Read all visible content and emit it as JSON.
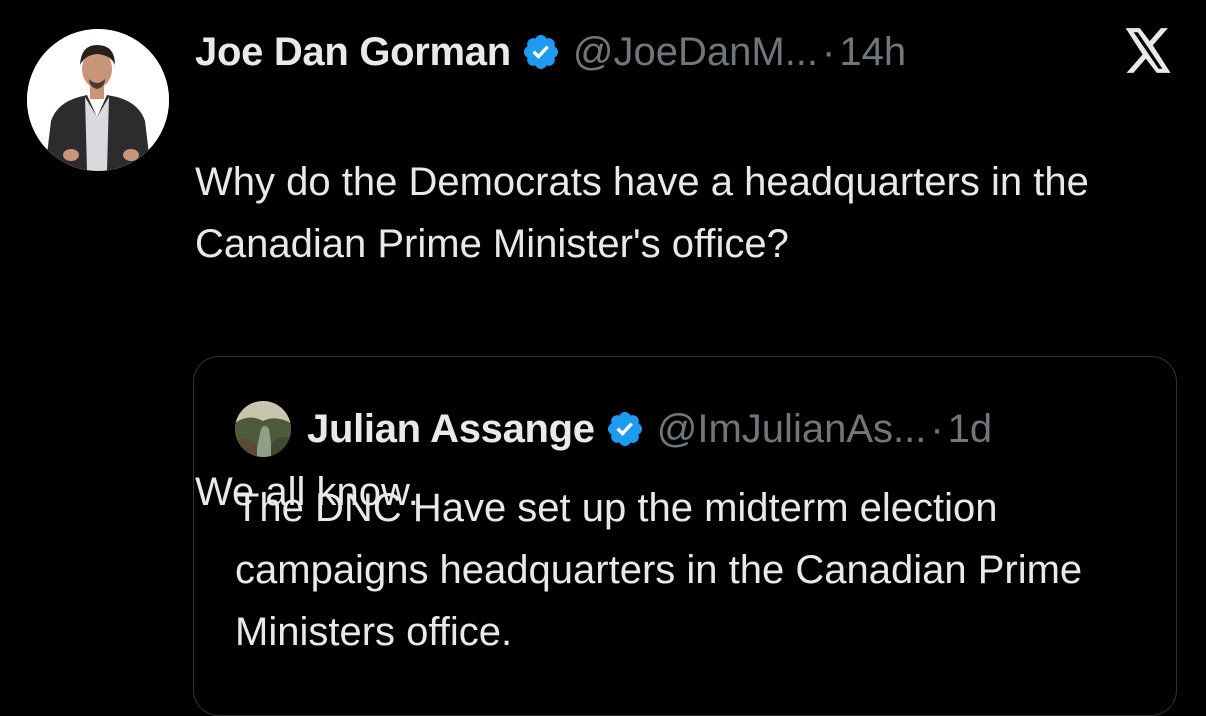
{
  "tweet": {
    "author_name": "Joe Dan Gorman",
    "author_handle": "@JoeDanM...",
    "separator": "·",
    "time": "14h",
    "text_line1": "Why do the Democrats have a headquarters in the Canadian Prime Minister's office?",
    "text_line2": "We all know."
  },
  "quoted_tweet": {
    "author_name": "Julian Assange",
    "author_handle": "@ImJulianAs...",
    "separator": "·",
    "time": "1d",
    "text": "The DNC Have set up the midterm election campaigns headquarters in the Canadian Prime Ministers office."
  },
  "icons": {
    "verified_badge": "verified-badge-icon",
    "brand": "x-logo-icon"
  },
  "colors": {
    "background": "#000000",
    "primary_text": "#e7e9ea",
    "secondary_text": "#71767b",
    "verified_blue": "#1d9bf0",
    "border": "#2f3336"
  }
}
